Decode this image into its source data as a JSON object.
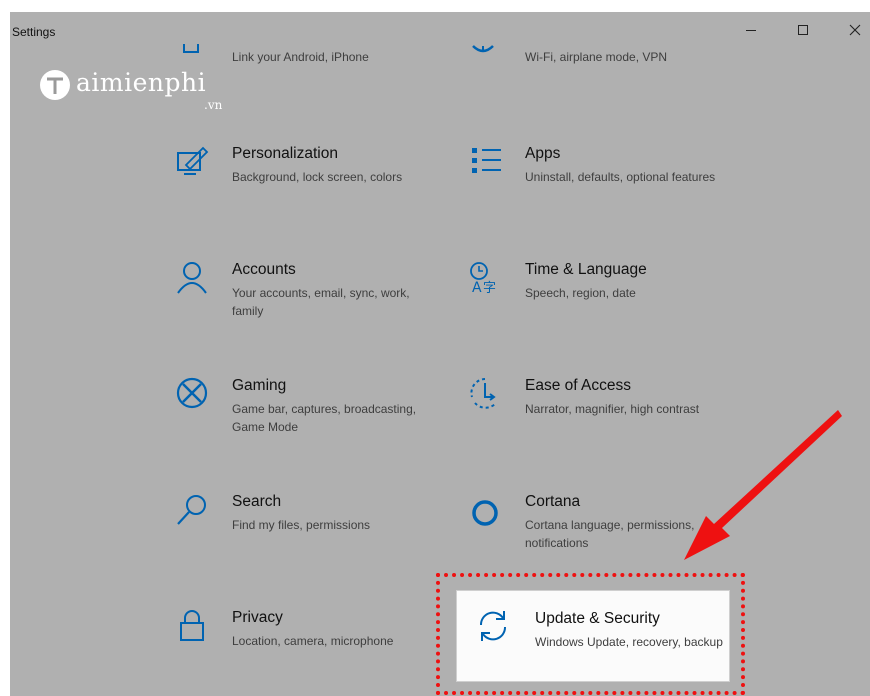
{
  "window": {
    "title": "Settings",
    "controls": [
      "minimize",
      "maximize",
      "close"
    ]
  },
  "watermark": {
    "brand": "Taimienphi",
    "brand_rest": "aimienphi",
    "suffix": ".vn"
  },
  "tiles": [
    {
      "key": "phone",
      "title": "",
      "desc": "Link your Android, iPhone",
      "icon": "phone-icon"
    },
    {
      "key": "network",
      "title": "",
      "desc": "Wi-Fi, airplane mode, VPN",
      "icon": "network-icon"
    },
    {
      "key": "personalization",
      "title": "Personalization",
      "desc": "Background, lock screen, colors",
      "icon": "personalization-icon"
    },
    {
      "key": "apps",
      "title": "Apps",
      "desc": "Uninstall, defaults, optional features",
      "icon": "apps-icon"
    },
    {
      "key": "accounts",
      "title": "Accounts",
      "desc": "Your accounts, email, sync, work, family",
      "icon": "person-icon"
    },
    {
      "key": "time",
      "title": "Time & Language",
      "desc": "Speech, region, date",
      "icon": "time-language-icon"
    },
    {
      "key": "gaming",
      "title": "Gaming",
      "desc": "Game bar, captures, broadcasting, Game Mode",
      "icon": "xbox-icon"
    },
    {
      "key": "ease",
      "title": "Ease of Access",
      "desc": "Narrator, magnifier, high contrast",
      "icon": "ease-of-access-icon"
    },
    {
      "key": "search",
      "title": "Search",
      "desc": "Find my files, permissions",
      "icon": "search-icon"
    },
    {
      "key": "cortana",
      "title": "Cortana",
      "desc": "Cortana language, permissions, notifications",
      "icon": "cortana-icon"
    },
    {
      "key": "privacy",
      "title": "Privacy",
      "desc": "Location, camera, microphone",
      "icon": "lock-icon"
    },
    {
      "key": "update",
      "title": "Update & Security",
      "desc": "Windows Update, recovery, backup",
      "icon": "sync-icon"
    }
  ],
  "colors": {
    "accent": "#0063b1",
    "overlay": "#b0b0b0",
    "annotation": "#ee1111"
  }
}
